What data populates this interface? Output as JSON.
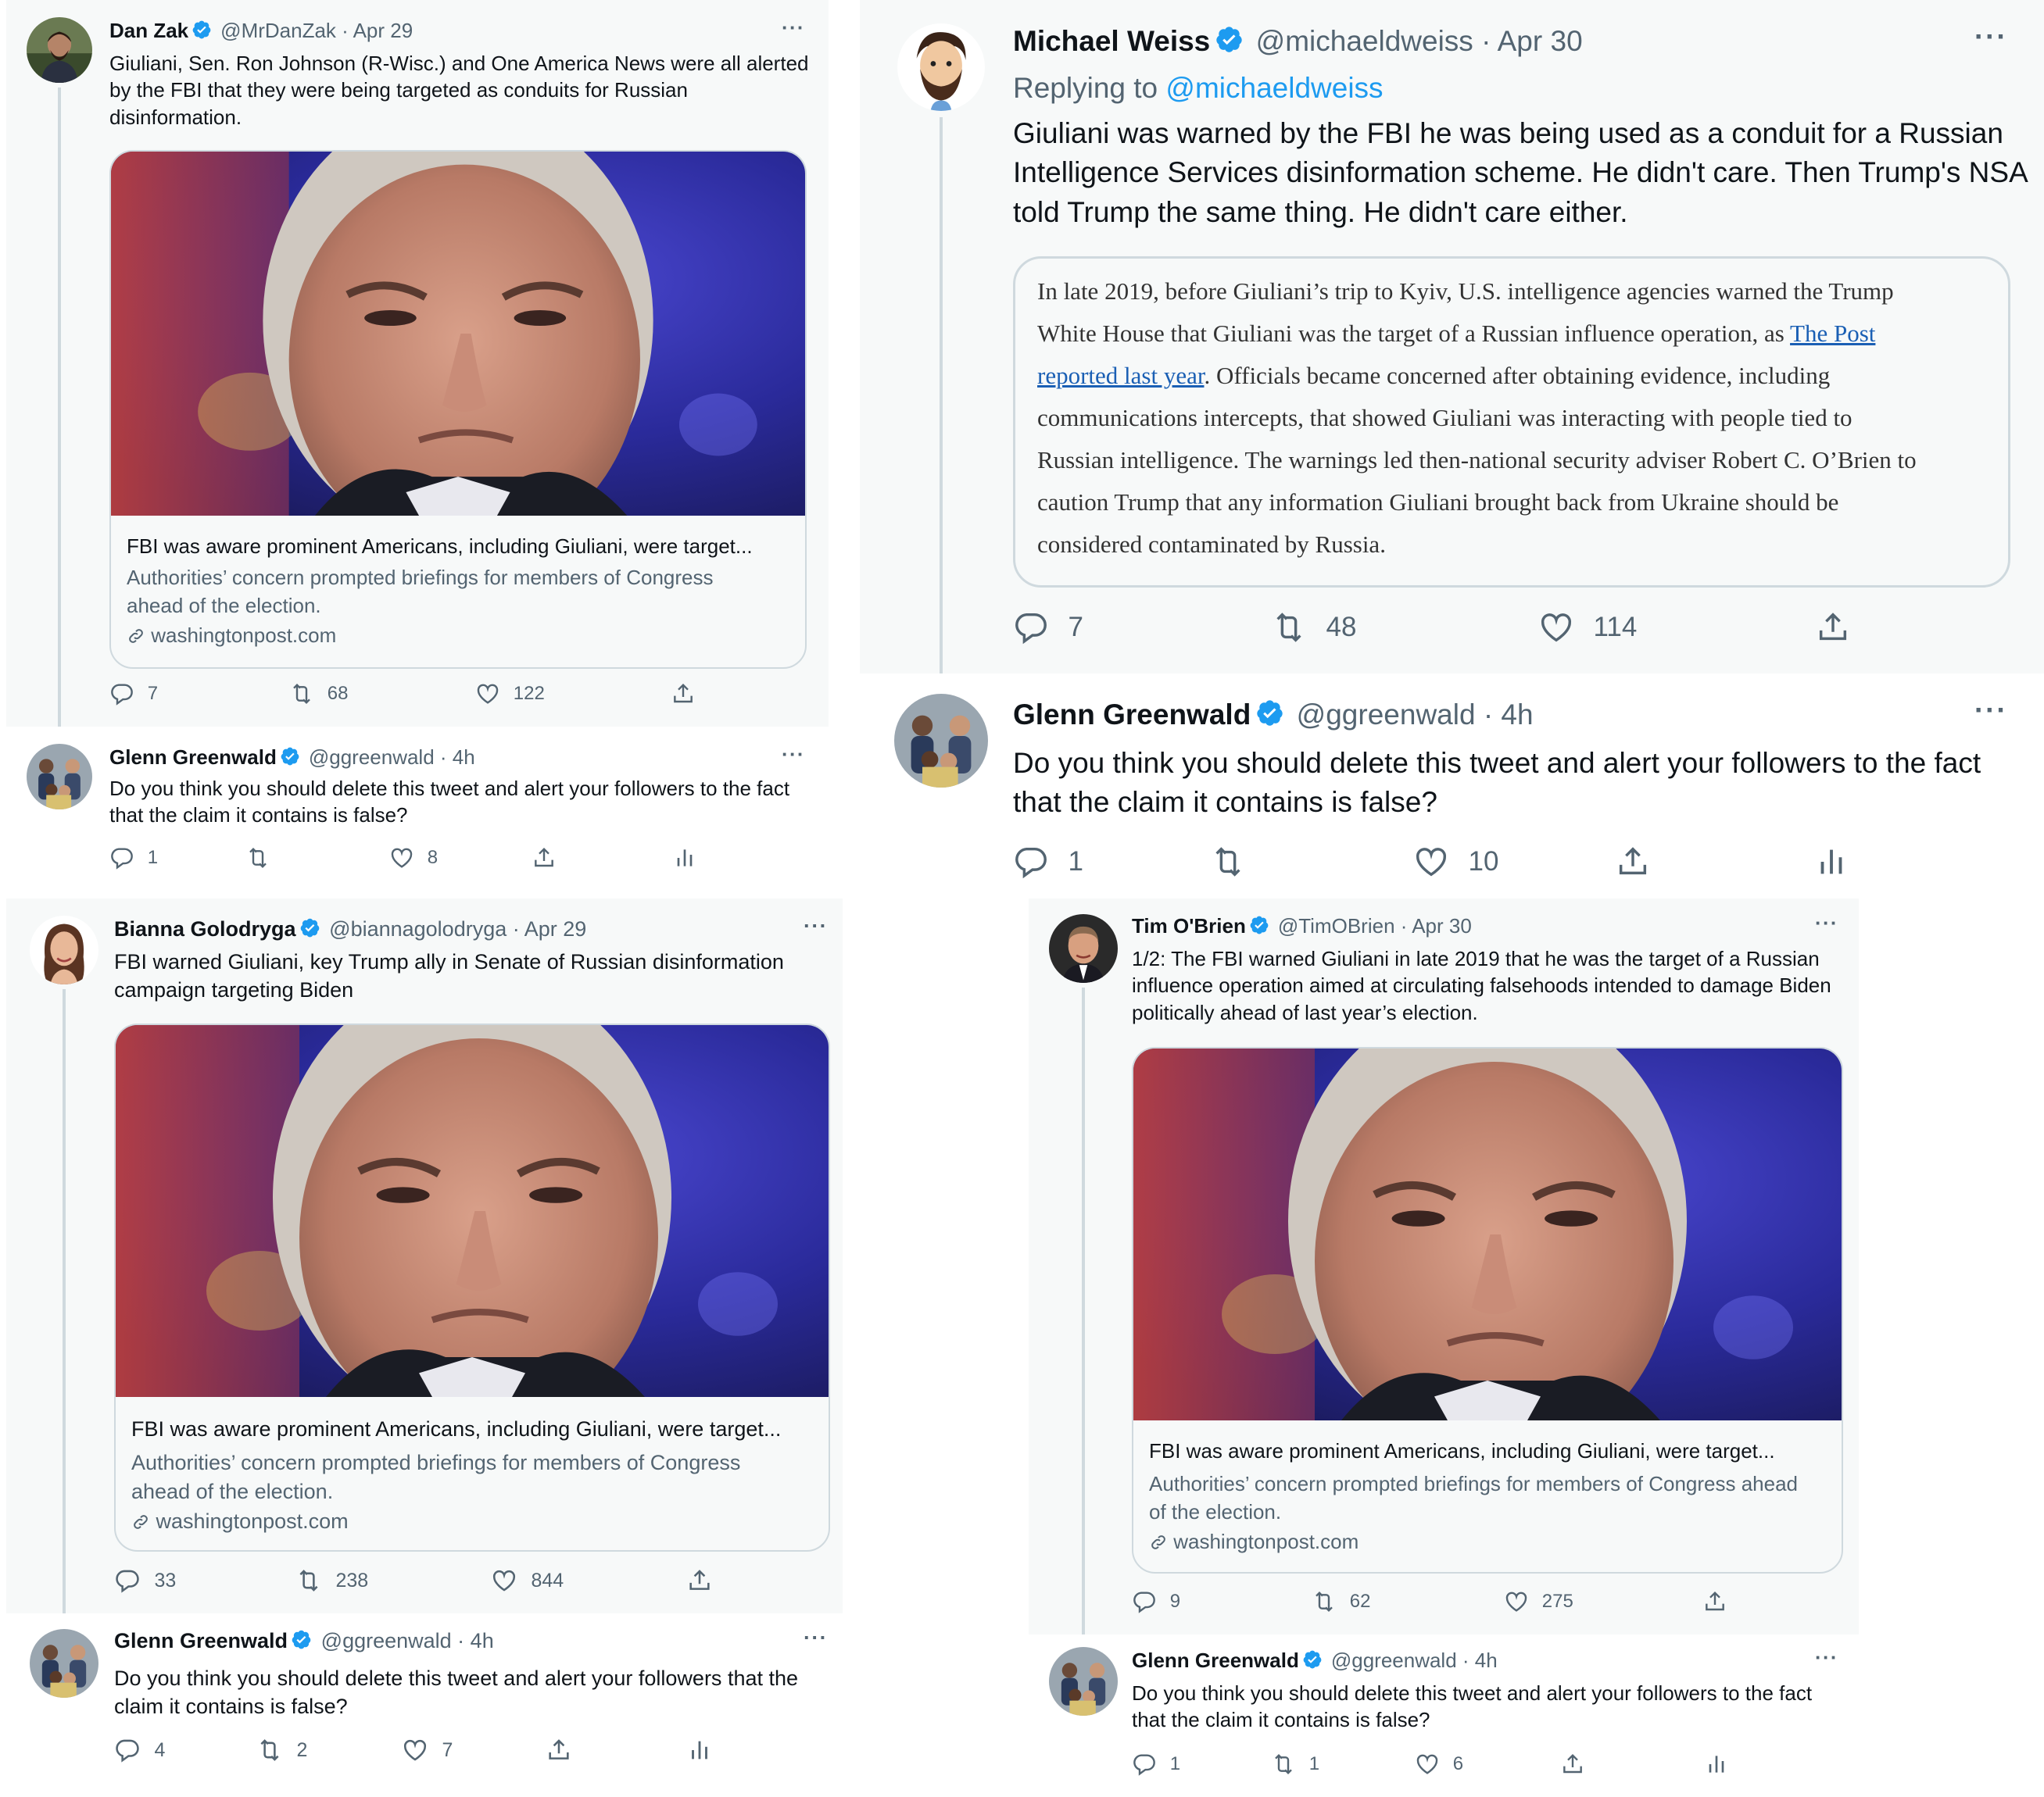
{
  "colors": {
    "blue": "#1d9bf0",
    "gray": "#536471",
    "border": "#cfd9de",
    "bg": "#f7f9f9"
  },
  "icons": [
    "verified-badge-icon",
    "more-icon",
    "reply-icon",
    "retweet-icon",
    "like-icon",
    "share-icon",
    "analytics-icon",
    "link-icon"
  ],
  "shared": {
    "more": "···",
    "glenn": {
      "name": "Glenn Greenwald",
      "handle": "@ggreenwald · 4h"
    },
    "wapo": {
      "title": "FBI was aware prominent Americans, including Giuliani, were target...",
      "desc": "Authorities’ concern prompted briefings for members of Congress ahead of the election.",
      "url": "washingtonpost.com"
    },
    "gg_text_a": "Do you think you should delete this tweet and alert your followers to the fact that the claim it contains is false?",
    "gg_text_b": "Do you think you should delete this tweet and alert your followers that the claim it contains is false?"
  },
  "p1": {
    "t1": {
      "name": "Dan Zak",
      "handle": "@MrDanZak · Apr 29",
      "text": "Giuliani, Sen. Ron Johnson (R-Wisc.) and One America News were all alerted by the FBI that they were being targeted as conduits for Russian disinformation.",
      "stats": {
        "reply": "7",
        "retweet": "68",
        "like": "122"
      }
    },
    "t2": {
      "stats": {
        "reply": "1",
        "like": "8"
      }
    }
  },
  "p2": {
    "t1": {
      "name": "Michael Weiss",
      "handle": "@michaeldweiss · Apr 30",
      "replying": "Replying to",
      "replying_handle": "@michaeldweiss",
      "text": "Giuliani was warned by the FBI he was being used as a conduit for a Russian Intelligence Services disinformation scheme. He didn't care. Then Trump's NSA told Trump the same thing. He didn't care either.",
      "stats": {
        "reply": "7",
        "retweet": "48",
        "like": "114"
      }
    },
    "quote": {
      "l1": "In late 2019, before Giuliani’s trip to Kyiv, U.S. intelligence agencies warned the Trump",
      "l2": "White House that Giuliani was the target of a Russian influence operation, as ",
      "l2_link": "The Post",
      "l3_link": "reported last year",
      "l3": ". Officials became concerned after obtaining evidence, including",
      "l4": "communications intercepts, that showed Giuliani was interacting with people tied to",
      "l5": "Russian intelligence. The warnings led then-national security adviser Robert C. O’Brien to",
      "l6": "caution Trump that any information Giuliani brought back from Ukraine should be",
      "l7": "considered contaminated by Russia."
    },
    "t2": {
      "stats": {
        "reply": "1",
        "like": "10"
      }
    }
  },
  "p3": {
    "t1": {
      "name": "Bianna Golodryga",
      "handle": "@biannagolodryga · Apr 29",
      "text": "FBI warned Giuliani, key Trump ally in Senate of Russian disinformation campaign targeting Biden",
      "stats": {
        "reply": "33",
        "retweet": "238",
        "like": "844"
      }
    },
    "t2": {
      "stats": {
        "reply": "4",
        "retweet": "2",
        "like": "7"
      }
    }
  },
  "p4": {
    "t1": {
      "name": "Tim O'Brien",
      "handle": "@TimOBrien · Apr 30",
      "text": "1/2: The FBI warned Giuliani in late 2019 that he was the target of a Russian influence operation aimed at circulating falsehoods intended to damage Biden politically ahead of last year’s election.",
      "stats": {
        "reply": "9",
        "retweet": "62",
        "like": "275"
      }
    },
    "t2": {
      "stats": {
        "reply": "1",
        "retweet": "1",
        "like": "6"
      }
    }
  }
}
